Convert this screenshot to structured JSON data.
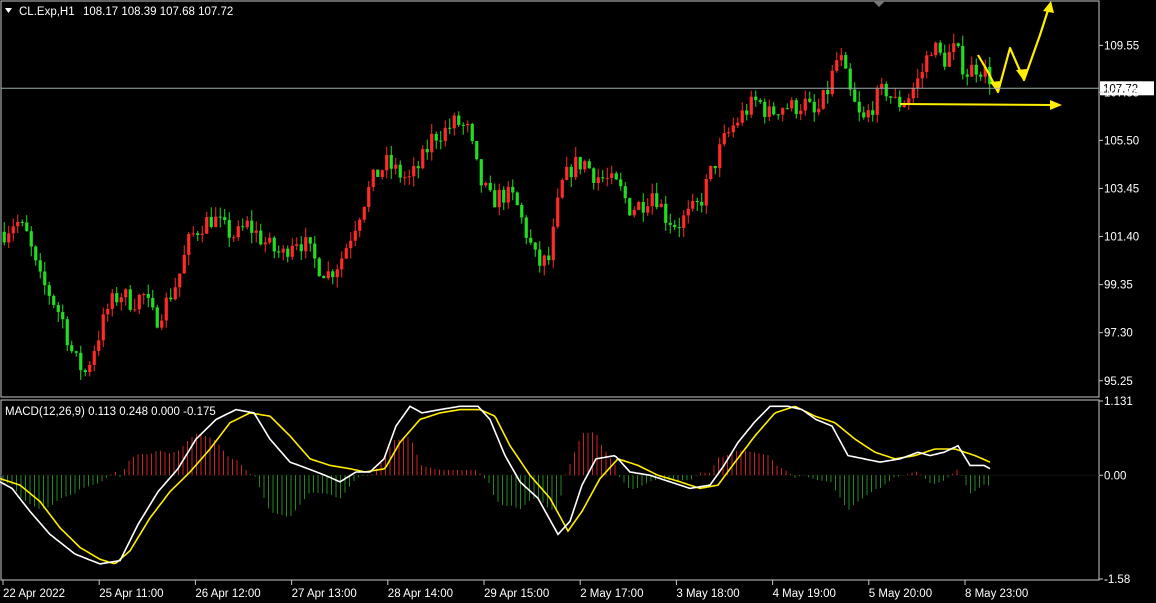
{
  "chart_data": [
    {
      "type": "candlestick",
      "symbol_label": "CL.Exp,H1",
      "ohlc_label": "108.17 108.39 107.68 107.72",
      "current_price_label": "107.72",
      "current_price": 107.72,
      "ylim": [
        94.6,
        111.4
      ],
      "y_ticks": [
        {
          "value": 109.55,
          "label": "109.55"
        },
        {
          "value": 107.55,
          "label": "107.55"
        },
        {
          "value": 105.5,
          "label": "105.50"
        },
        {
          "value": 103.45,
          "label": "103.45"
        },
        {
          "value": 101.4,
          "label": "101.40"
        },
        {
          "value": 99.35,
          "label": "99.35"
        },
        {
          "value": 97.3,
          "label": "97.30"
        },
        {
          "value": 95.25,
          "label": "95.25"
        }
      ],
      "x_ticks": [
        "22 Apr 2022",
        "25 Apr 11:00",
        "26 Apr 12:00",
        "27 Apr 13:00",
        "28 Apr 14:00",
        "29 Apr 15:00",
        "2 May 17:00",
        "3 May 18:00",
        "4 May 19:00",
        "5 May 20:00",
        "8 May 23:00"
      ],
      "bull_color": "#ff2a2a",
      "bear_color": "#22dd22",
      "anchors": [
        101.6,
        102.1,
        101.4,
        99.6,
        98.9,
        97.9,
        96.2,
        95.6,
        97.0,
        98.4,
        99.0,
        98.6,
        98.9,
        97.8,
        98.6,
        99.6,
        101.3,
        101.9,
        102.2,
        101.7,
        101.4,
        101.9,
        101.4,
        100.9,
        100.6,
        101.4,
        101.0,
        100.2,
        99.8,
        100.4,
        101.6,
        102.9,
        104.0,
        104.5,
        104.1,
        103.8,
        104.6,
        105.7,
        105.9,
        106.3,
        105.9,
        103.8,
        102.9,
        103.2,
        103.0,
        101.6,
        100.2,
        100.4,
        103.5,
        104.4,
        104.6,
        104.0,
        103.8,
        103.5,
        102.6,
        102.8,
        103.4,
        102.3,
        101.9,
        102.3,
        102.8,
        104.2,
        105.4,
        106.2,
        106.8,
        107.2,
        106.6,
        107.0,
        106.9,
        107.1,
        106.5,
        107.6,
        109.2,
        107.4,
        106.2,
        107.1,
        107.7,
        107.0,
        107.4,
        108.2,
        109.6,
        108.9,
        109.4,
        108.4,
        108.7,
        108.2
      ]
    },
    {
      "type": "line",
      "indicator_label": "MACD(12,26,9) 0.113 0.248 0.000 -0.175",
      "ylim": [
        -1.58,
        1.131
      ],
      "y_ticks": [
        {
          "value": 1.131,
          "label": "1.131"
        },
        {
          "value": 0.0,
          "label": "0.00"
        },
        {
          "value": -1.58,
          "label": "-1.58"
        }
      ],
      "main_color": "#ffffff",
      "signal_color": "#ffee00",
      "hist_pos_color": "#cc2222",
      "hist_neg_color": "#1f8a1f",
      "macd_anchors": [
        [
          0,
          -0.1
        ],
        [
          12,
          -0.2
        ],
        [
          30,
          -0.55
        ],
        [
          50,
          -0.9
        ],
        [
          75,
          -1.2
        ],
        [
          100,
          -1.35
        ],
        [
          120,
          -1.3
        ],
        [
          138,
          -0.75
        ],
        [
          158,
          -0.25
        ],
        [
          178,
          0.1
        ],
        [
          196,
          0.55
        ],
        [
          216,
          0.85
        ],
        [
          236,
          1.0
        ],
        [
          254,
          0.95
        ],
        [
          270,
          0.55
        ],
        [
          290,
          0.2
        ],
        [
          308,
          0.1
        ],
        [
          325,
          0.0
        ],
        [
          340,
          -0.1
        ],
        [
          356,
          0.05
        ],
        [
          370,
          0.05
        ],
        [
          384,
          0.25
        ],
        [
          396,
          0.75
        ],
        [
          410,
          1.05
        ],
        [
          422,
          0.95
        ],
        [
          440,
          1.0
        ],
        [
          460,
          1.05
        ],
        [
          478,
          1.05
        ],
        [
          490,
          0.85
        ],
        [
          505,
          0.3
        ],
        [
          520,
          -0.1
        ],
        [
          538,
          -0.35
        ],
        [
          558,
          -0.9
        ],
        [
          570,
          -0.7
        ],
        [
          582,
          -0.15
        ],
        [
          596,
          0.25
        ],
        [
          615,
          0.3
        ],
        [
          630,
          0.05
        ],
        [
          650,
          0.0
        ],
        [
          670,
          -0.1
        ],
        [
          690,
          -0.2
        ],
        [
          710,
          -0.15
        ],
        [
          724,
          0.15
        ],
        [
          738,
          0.5
        ],
        [
          754,
          0.8
        ],
        [
          770,
          1.05
        ],
        [
          788,
          1.05
        ],
        [
          802,
          1.0
        ],
        [
          816,
          0.85
        ],
        [
          832,
          0.75
        ],
        [
          848,
          0.3
        ],
        [
          864,
          0.25
        ],
        [
          880,
          0.2
        ],
        [
          900,
          0.25
        ],
        [
          918,
          0.35
        ],
        [
          930,
          0.3
        ],
        [
          944,
          0.35
        ],
        [
          958,
          0.45
        ],
        [
          970,
          0.15
        ],
        [
          984,
          0.15
        ],
        [
          990,
          0.1
        ]
      ],
      "signal_anchors": [
        [
          0,
          -0.05
        ],
        [
          20,
          -0.15
        ],
        [
          40,
          -0.4
        ],
        [
          60,
          -0.8
        ],
        [
          80,
          -1.1
        ],
        [
          100,
          -1.28
        ],
        [
          115,
          -1.35
        ],
        [
          130,
          -1.15
        ],
        [
          150,
          -0.65
        ],
        [
          170,
          -0.25
        ],
        [
          190,
          0.05
        ],
        [
          210,
          0.4
        ],
        [
          230,
          0.8
        ],
        [
          250,
          0.95
        ],
        [
          270,
          0.9
        ],
        [
          290,
          0.6
        ],
        [
          310,
          0.25
        ],
        [
          330,
          0.15
        ],
        [
          350,
          0.1
        ],
        [
          365,
          0.05
        ],
        [
          385,
          0.1
        ],
        [
          400,
          0.5
        ],
        [
          420,
          0.85
        ],
        [
          440,
          0.95
        ],
        [
          460,
          1.0
        ],
        [
          480,
          1.0
        ],
        [
          495,
          0.9
        ],
        [
          510,
          0.45
        ],
        [
          530,
          0.0
        ],
        [
          550,
          -0.35
        ],
        [
          568,
          -0.85
        ],
        [
          582,
          -0.55
        ],
        [
          600,
          -0.05
        ],
        [
          618,
          0.25
        ],
        [
          638,
          0.15
        ],
        [
          658,
          0.0
        ],
        [
          680,
          -0.1
        ],
        [
          700,
          -0.2
        ],
        [
          718,
          -0.15
        ],
        [
          735,
          0.2
        ],
        [
          755,
          0.6
        ],
        [
          775,
          0.95
        ],
        [
          795,
          1.05
        ],
        [
          815,
          0.9
        ],
        [
          835,
          0.8
        ],
        [
          855,
          0.55
        ],
        [
          875,
          0.35
        ],
        [
          895,
          0.25
        ],
        [
          915,
          0.3
        ],
        [
          935,
          0.4
        ],
        [
          955,
          0.4
        ],
        [
          975,
          0.3
        ],
        [
          990,
          0.2
        ]
      ]
    }
  ],
  "annotations": {
    "arrow_color": "#ffee00",
    "horizontal_level": 107.05
  }
}
